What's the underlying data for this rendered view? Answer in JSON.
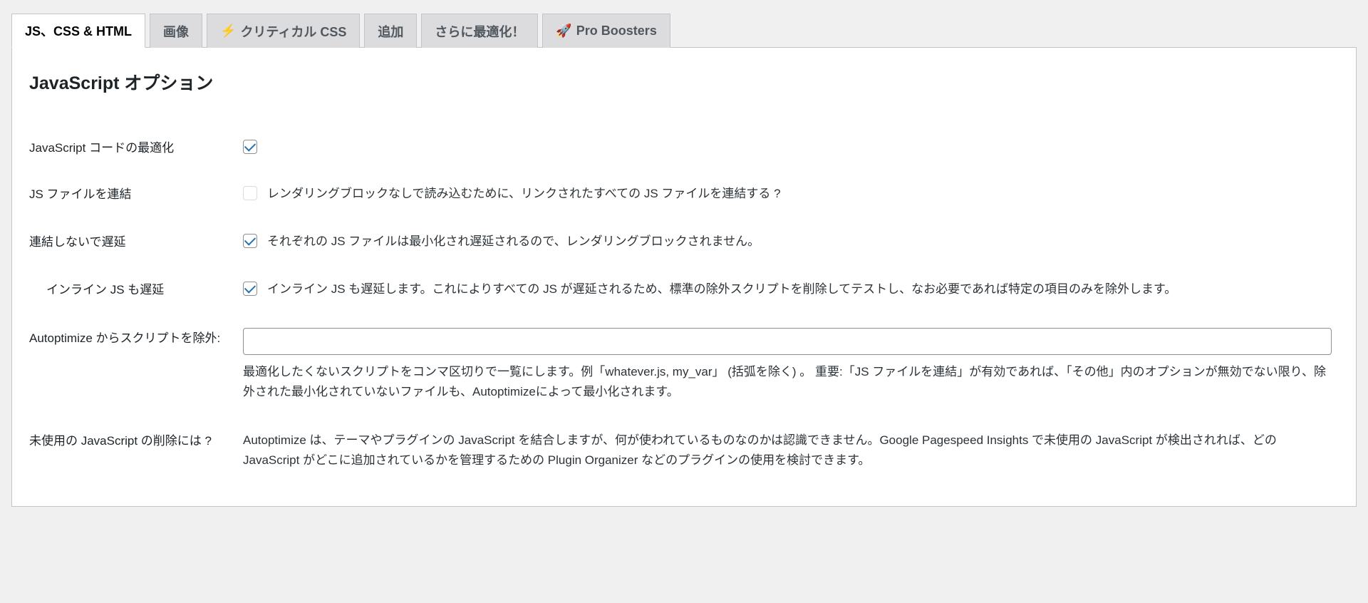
{
  "tabs": [
    {
      "label": "JS、CSS & HTML",
      "active": true
    },
    {
      "label": "画像"
    },
    {
      "label": "クリティカル CSS",
      "icon": "bolt"
    },
    {
      "label": "追加"
    },
    {
      "label": "さらに最適化！"
    },
    {
      "label": "Pro Boosters",
      "icon": "rocket"
    }
  ],
  "section_title": "JavaScript オプション",
  "rows": {
    "optimize_js": {
      "label": "JavaScript コードの最適化",
      "checked": true,
      "desc": ""
    },
    "aggregate_js": {
      "label": "JS ファイルを連結",
      "checked": false,
      "disabled": true,
      "desc": "レンダリングブロックなしで読み込むために、リンクされたすべての JS ファイルを連結する ?"
    },
    "defer_not_aggregate": {
      "label": "連結しないで遅延",
      "checked": true,
      "desc": "それぞれの JS ファイルは最小化され遅延されるので、レンダリングブロックされません。"
    },
    "defer_inline": {
      "label": "インライン JS も遅延",
      "checked": true,
      "desc": "インライン JS も遅延します。これによりすべての JS が遅延されるため、標準の除外スクリプトを削除してテストし、なお必要であれば特定の項目のみを除外します。"
    },
    "exclude": {
      "label": "Autoptimize からスクリプトを除外:",
      "value": "",
      "help": "最適化したくないスクリプトをコンマ区切りで一覧にします。例「whatever.js, my_var」 (括弧を除く) 。 重要:「JS ファイルを連結」が有効であれば、「その他」内のオプションが無効でない限り、除外された最小化されていないファイルも、Autoptimizeによって最小化されます。"
    },
    "remove_unused": {
      "label": "未使用の JavaScript の削除には ?",
      "help": "Autoptimize は、テーマやプラグインの JavaScript を結合しますが、何が使われているものなのかは認識できません。Google Pagespeed Insights で未使用の JavaScript が検出されれば、どの JavaScript がどこに追加されているかを管理するための Plugin Organizer などのプラグインの使用を検討できます。"
    }
  }
}
